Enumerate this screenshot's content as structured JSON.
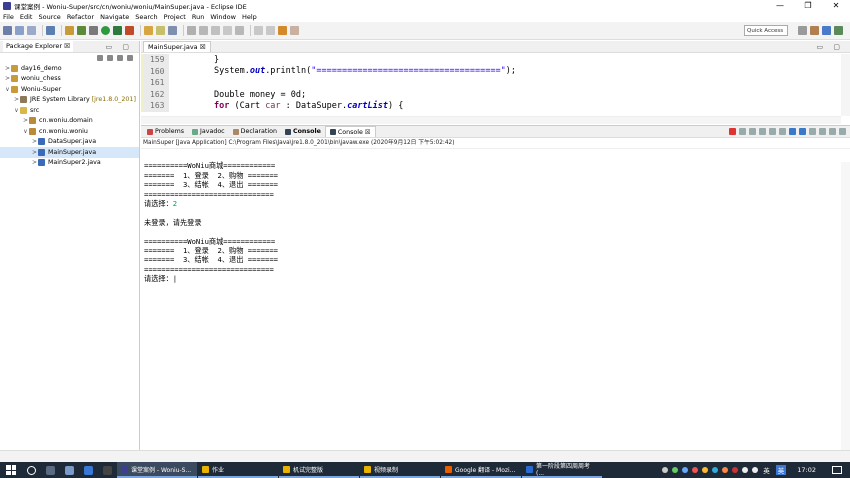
{
  "window": {
    "title": "课堂案例 - Woniu-Super/src/cn/woniu/woniu/MainSuper.java - Eclipse IDE",
    "controls": [
      "—",
      "❐",
      "✕"
    ]
  },
  "menu": [
    "File",
    "Edit",
    "Source",
    "Refactor",
    "Navigate",
    "Search",
    "Project",
    "Run",
    "Window",
    "Help"
  ],
  "toolbar": {
    "quick_access": "Quick Access"
  },
  "package_explorer": {
    "tab_label": "Package Explorer ☒",
    "tree": [
      {
        "label": "day16_demo",
        "arrow": ">",
        "indent": 0
      },
      {
        "label": "woniu_chess",
        "arrow": ">",
        "indent": 0
      },
      {
        "label": "Woniu-Super",
        "arrow": "∨",
        "indent": 0
      },
      {
        "label": "JRE System Library",
        "deco": "[jre1.8.0_201]",
        "arrow": ">",
        "indent": 1
      },
      {
        "label": "src",
        "arrow": "∨",
        "indent": 1
      },
      {
        "label": "cn.woniu.domain",
        "arrow": ">",
        "indent": 2
      },
      {
        "label": "cn.woniu.woniu",
        "arrow": "∨",
        "indent": 2
      },
      {
        "label": "DataSuper.java",
        "arrow": ">",
        "indent": 3
      },
      {
        "label": "MainSuper.java",
        "arrow": ">",
        "indent": 3,
        "selected": true
      },
      {
        "label": "MainSuper2.java",
        "arrow": ">",
        "indent": 3
      }
    ]
  },
  "editor": {
    "tab_label": "MainSuper.java ☒",
    "lines": [
      {
        "no": "159",
        "text": "}"
      },
      {
        "no": "160",
        "pre": "System.",
        "field": "out",
        "mid": ".println(",
        "str": "\"====================================\"",
        "post": ");"
      },
      {
        "no": "161",
        "text": ""
      },
      {
        "no": "162",
        "text": "Double money = 0d;"
      },
      {
        "no": "163",
        "kw": "for",
        "pre2": " (Cart ",
        "var": "car",
        "mid2": " : DataSuper.",
        "field2": "cartList",
        "post2": ") {"
      }
    ]
  },
  "console": {
    "tabs": [
      "Problems",
      "Javadoc",
      "Declaration",
      "Console",
      "Console ☒"
    ],
    "launch_info": "MainSuper [Java Application] C:\\Program Files\\Java\\jre1.8.0_201\\bin\\javaw.exe (2020年9月12日 下午5:02:42)",
    "output": [
      {
        "text": ""
      },
      {
        "text": "==========WoNiu商城============"
      },
      {
        "text": "=======  1、登录  2、购物 ======="
      },
      {
        "text": "=======  3、结帐  4、退出 ======="
      },
      {
        "text": "=============================="
      },
      {
        "text": "请选择：",
        "input": "2"
      },
      {
        "text": ""
      },
      {
        "text": "未登录，请先登录"
      },
      {
        "text": ""
      },
      {
        "text": "==========WoNiu商城============"
      },
      {
        "text": "=======  1、登录  2、购物 ======="
      },
      {
        "text": "=======  3、结帐  4、退出 ======="
      },
      {
        "text": "=============================="
      },
      {
        "text": "请选择：|"
      }
    ]
  },
  "taskbar": {
    "tasks": [
      {
        "label": "课堂案例 - Woniu-S...",
        "color": "#3c3f8f",
        "active": true
      },
      {
        "label": "作业",
        "color": "#e8b400"
      },
      {
        "label": "机试完整版",
        "color": "#e8b400"
      },
      {
        "label": "视频录制",
        "color": "#e8b400"
      },
      {
        "label": "Google 翻译 - Mozi...",
        "color": "#e66000"
      },
      {
        "label": "第一阶段第四周周考(...",
        "color": "#2b6ad0"
      }
    ],
    "tray_lang": "英",
    "tray_ime": "英",
    "clock": "17:02"
  }
}
